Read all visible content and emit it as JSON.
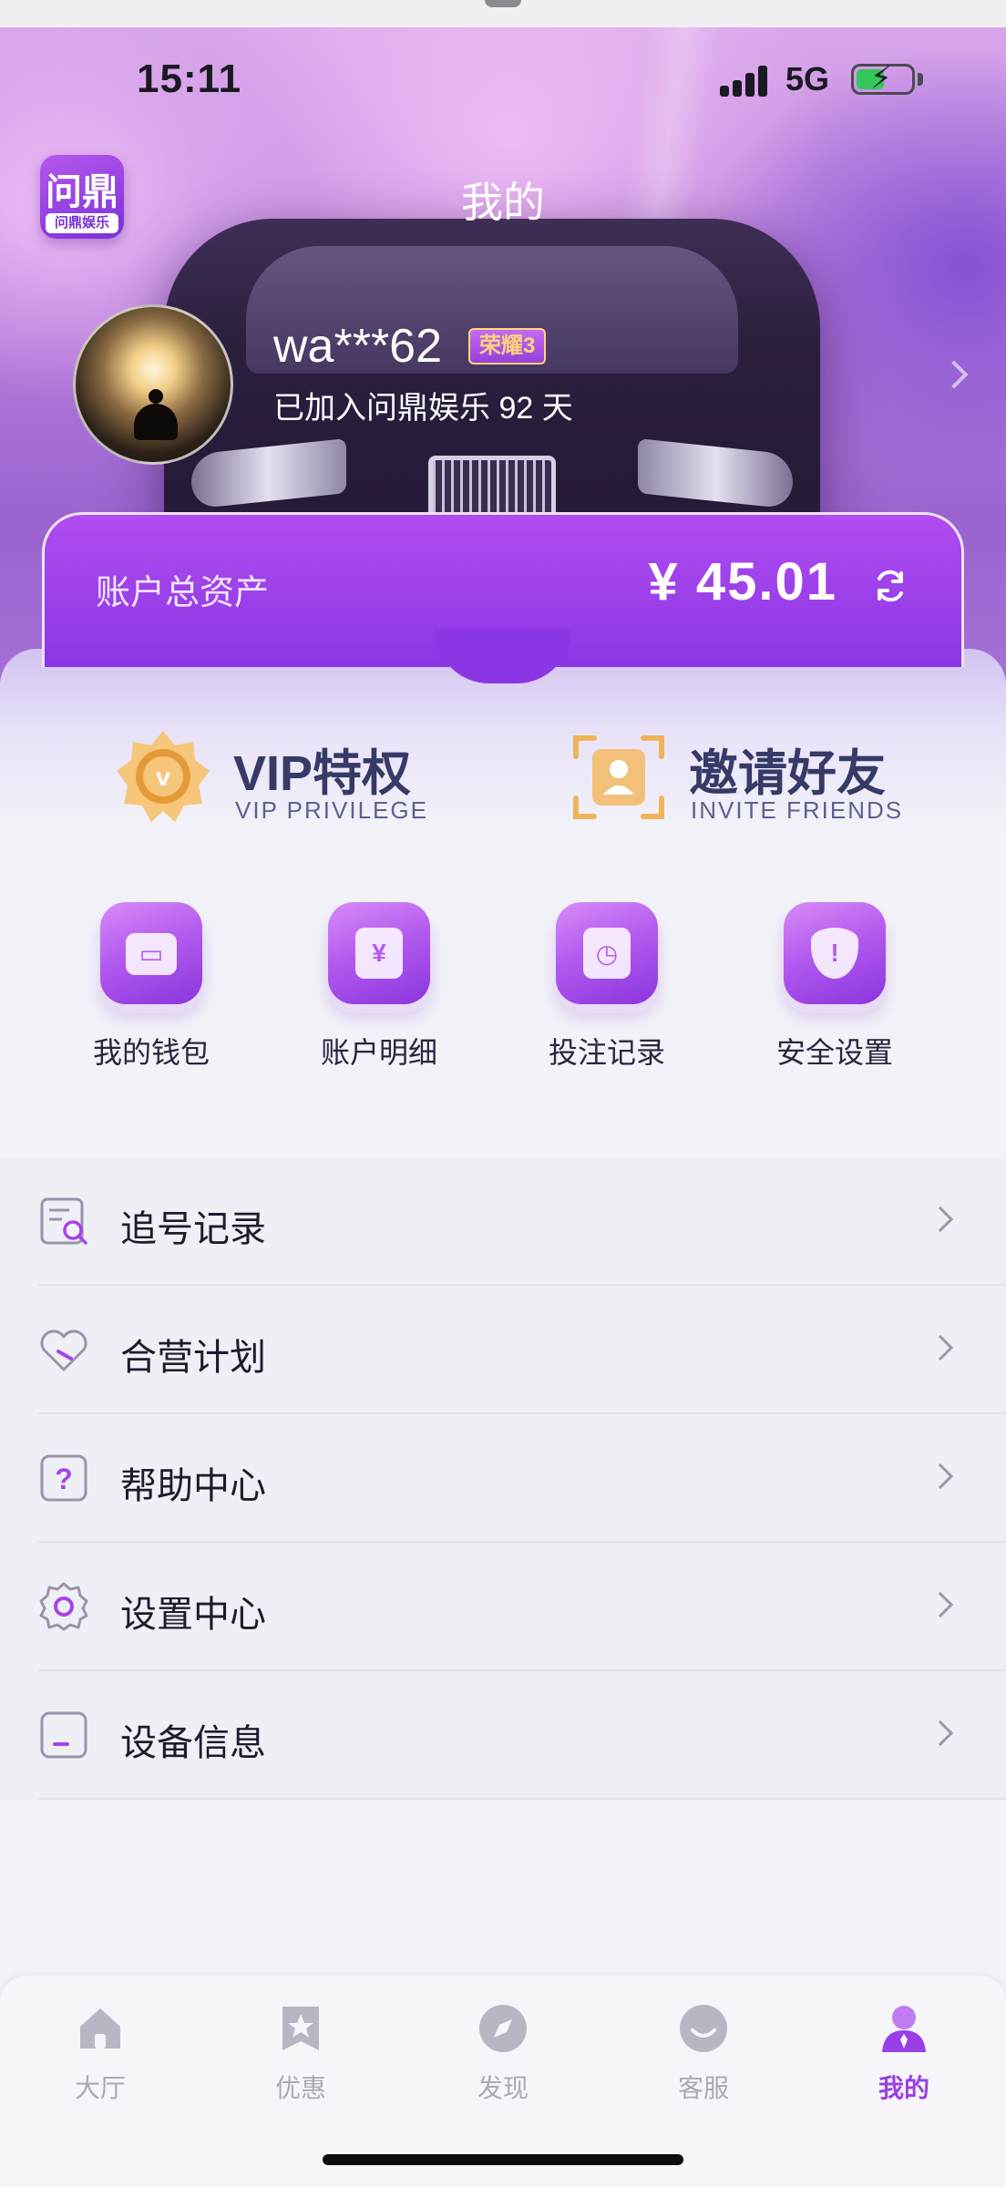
{
  "status_bar": {
    "time": "15:11",
    "network": "5G"
  },
  "header": {
    "app_logo_text": "问鼎",
    "app_logo_name": "问鼎娱乐",
    "title": "我的"
  },
  "profile": {
    "username": "wa***62",
    "rank_badge": "荣耀3",
    "joined_text": "已加入问鼎娱乐 92 天"
  },
  "assets": {
    "label": "账户总资产",
    "value": "¥ 45.01"
  },
  "features": [
    {
      "title": "VIP特权",
      "subtitle": "VIP PRIVILEGE",
      "icon": "vip-badge-icon"
    },
    {
      "title": "邀请好友",
      "subtitle": "INVITE FRIENDS",
      "icon": "invite-friends-icon"
    }
  ],
  "quick_actions": [
    {
      "label": "我的钱包",
      "icon": "wallet-icon"
    },
    {
      "label": "账户明细",
      "icon": "account-detail-icon"
    },
    {
      "label": "投注记录",
      "icon": "bet-record-icon"
    },
    {
      "label": "安全设置",
      "icon": "security-shield-icon"
    }
  ],
  "menu": [
    {
      "label": "追号记录",
      "icon": "chase-record-icon"
    },
    {
      "label": "合营计划",
      "icon": "partnership-icon"
    },
    {
      "label": "帮助中心",
      "icon": "help-icon"
    },
    {
      "label": "设置中心",
      "icon": "settings-gear-icon"
    },
    {
      "label": "设备信息",
      "icon": "device-icon"
    }
  ],
  "tabbar": [
    {
      "label": "大厅",
      "icon": "home-icon",
      "active": false
    },
    {
      "label": "优惠",
      "icon": "promotion-star-icon",
      "active": false
    },
    {
      "label": "发现",
      "icon": "discover-compass-icon",
      "active": false
    },
    {
      "label": "客服",
      "icon": "customer-service-icon",
      "active": false
    },
    {
      "label": "我的",
      "icon": "profile-icon",
      "active": true
    }
  ],
  "colors": {
    "accent": "#9a3fe6",
    "accent_dark": "#8a36e4",
    "title_navy": "#353a66",
    "inactive": "#a9a9b6"
  }
}
